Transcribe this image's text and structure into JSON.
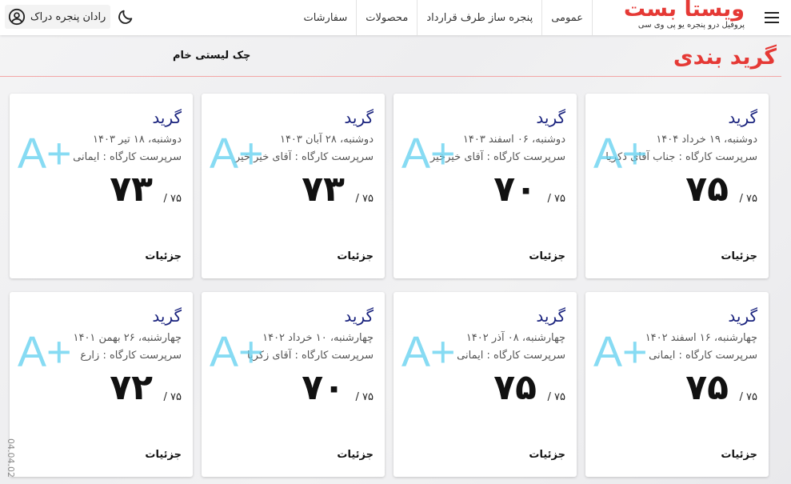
{
  "header": {
    "logo_main": "ویستا بست",
    "logo_sub": "پروفیل درو پنجره یو پی وی سی",
    "nav": [
      "عمومی",
      "پنجره ساز طرف قرارداد",
      "محصولات",
      "سفارشات"
    ],
    "user_name": "رادان پنجره دراک"
  },
  "page": {
    "title": "گرید بندی",
    "checklist_link": "چک لیستی خام",
    "version": "04.04.02"
  },
  "cards": [
    {
      "title": "گرید",
      "date": "دوشنبه، ۱۹ خرداد ۱۴۰۴",
      "supervisor": "سرپرست کارگاه : جناب آقای ذکریا",
      "grade": "A+",
      "score": "۷۵",
      "max": "/ ۷۵",
      "details": "جزئیات"
    },
    {
      "title": "گرید",
      "date": "دوشنبه، ۰۶ اسفند ۱۴۰۳",
      "supervisor": "سرپرست کارگاه : آقای خیرخیر",
      "grade": "A+",
      "score": "۷۰",
      "max": "/ ۷۵",
      "details": "جزئیات"
    },
    {
      "title": "گرید",
      "date": "دوشنبه، ۲۸ آبان ۱۴۰۳",
      "supervisor": "سرپرست کارگاه : آقای خیر خیر",
      "grade": "A+",
      "score": "۷۳",
      "max": "/ ۷۵",
      "details": "جزئیات"
    },
    {
      "title": "گرید",
      "date": "دوشنبه، ۱۸ تیر ۱۴۰۳",
      "supervisor": "سرپرست کارگاه : ایمانی",
      "grade": "A+",
      "score": "۷۳",
      "max": "/ ۷۵",
      "details": "جزئیات"
    },
    {
      "title": "گرید",
      "date": "چهارشنبه، ۱۶ اسفند ۱۴۰۲",
      "supervisor": "سرپرست کارگاه : ایمانی",
      "grade": "A+",
      "score": "۷۵",
      "max": "/ ۷۵",
      "details": "جزئیات"
    },
    {
      "title": "گرید",
      "date": "چهارشنبه، ۰۸ آذر ۱۴۰۲",
      "supervisor": "سرپرست کارگاه : ایمانی",
      "grade": "A+",
      "score": "۷۵",
      "max": "/ ۷۵",
      "details": "جزئیات"
    },
    {
      "title": "گرید",
      "date": "چهارشنبه، ۱۰ خرداد ۱۴۰۲",
      "supervisor": "سرپرست کارگاه : آقای زکریا",
      "grade": "A+",
      "score": "۷۰",
      "max": "/ ۷۵",
      "details": "جزئیات"
    },
    {
      "title": "گرید",
      "date": "چهارشنبه، ۲۶ بهمن ۱۴۰۱",
      "supervisor": "سرپرست کارگاه : زارع",
      "grade": "A+",
      "score": "۷۲",
      "max": "/ ۷۵",
      "details": "جزئیات"
    }
  ],
  "icons": {
    "menu": "hamburger-icon",
    "user": "user-circle-icon",
    "theme": "moon-icon"
  },
  "colors": {
    "brand": "#e53935",
    "card_title": "#1a237e",
    "grade": "#60d0ef"
  }
}
